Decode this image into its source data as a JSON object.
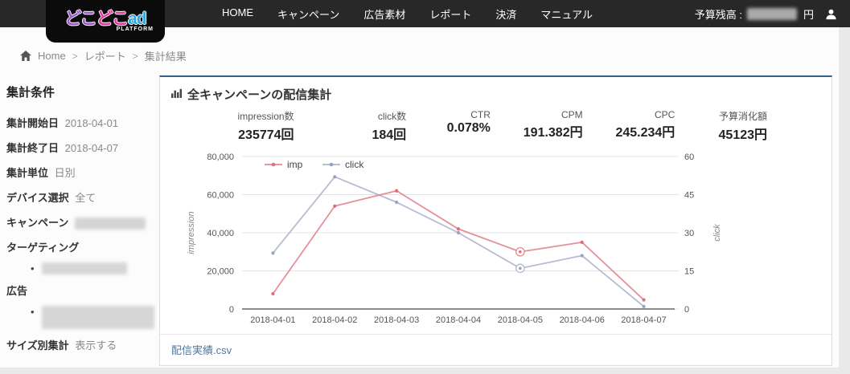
{
  "nav": {
    "logo": {
      "part1": "どこ",
      "part2": "どこ",
      "part3": "ad",
      "subtitle": "PLATFORM",
      "color1": "#9955cc",
      "color2": "#e0399a",
      "color3": "#2fa8e0"
    },
    "items": [
      "HOME",
      "キャンペーン",
      "広告素材",
      "レポート",
      "決済",
      "マニュアル"
    ],
    "budget_label": "予算残高 :",
    "budget_unit": "円"
  },
  "breadcrumb": {
    "home": "Home",
    "sep": ">",
    "level2": "レポート",
    "level3": "集計結果"
  },
  "sidebar": {
    "title": "集計条件",
    "fields": [
      {
        "label": "集計開始日",
        "value": "2018-04-01"
      },
      {
        "label": "集計終了日",
        "value": "2018-04-07"
      },
      {
        "label": "集計単位",
        "value": "日別"
      },
      {
        "label": "デバイス選択",
        "value": "全て"
      },
      {
        "label": "キャンペーン",
        "value": ""
      }
    ],
    "targeting_label": "ターゲティング",
    "ad_label": "広告",
    "size_label": "サイズ別集計",
    "size_value": "表示する"
  },
  "panel": {
    "title": "全キャンペーンの配信集計",
    "metrics": [
      {
        "label": "impression数",
        "value": "235774回"
      },
      {
        "label": "click数",
        "value": "184回"
      },
      {
        "label": "CTR",
        "value": "0.078%"
      },
      {
        "label": "CPM",
        "value": "191.382円"
      },
      {
        "label": "CPC",
        "value": "245.234円"
      },
      {
        "label": "予算消化額",
        "value": "45123円"
      }
    ],
    "footer_link": "配信実績.csv"
  },
  "chart_data": {
    "type": "line",
    "x": [
      "2018-04-01",
      "2018-04-02",
      "2018-04-03",
      "2018-04-04",
      "2018-04-05",
      "2018-04-06",
      "2018-04-07"
    ],
    "series": [
      {
        "name": "click",
        "axis": "right",
        "color": "#aeb5cd",
        "marker_color": "#9aa3c0",
        "values": [
          22,
          52,
          42,
          30,
          16,
          21,
          1
        ],
        "highlight_index": 4
      },
      {
        "name": "imp",
        "axis": "left",
        "color": "#e2848f",
        "marker_color": "#d8707f",
        "values": [
          8000,
          54000,
          62000,
          42000,
          30000,
          35000,
          4774
        ],
        "highlight_index": 4
      }
    ],
    "legend_order": [
      "imp",
      "click"
    ],
    "legend_position": "top-left",
    "grid": true,
    "left_axis": {
      "label": "impression",
      "min": 0,
      "max": 80000,
      "ticks": [
        "80,000",
        "60,000",
        "40,000",
        "20,000",
        "0"
      ]
    },
    "right_axis": {
      "label": "click",
      "min": 0,
      "max": 60,
      "ticks": [
        "60",
        "45",
        "30",
        "15",
        "0"
      ]
    },
    "grid_color": "#e4e4e4",
    "axis_line_color": "#666",
    "tick_text_color": "#555"
  }
}
